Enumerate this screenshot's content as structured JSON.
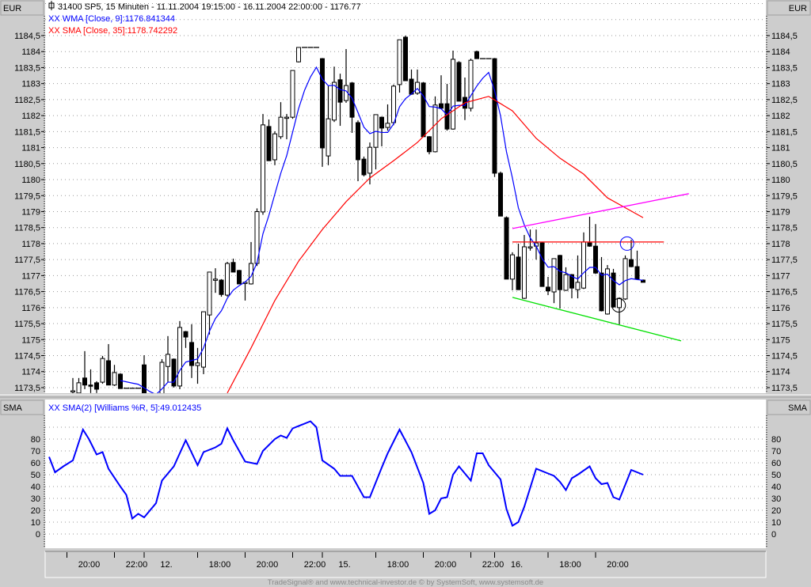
{
  "header": {
    "instrument_line": "31400  SP5, 15 Minuten - 11.11.2004 19:15:00 - 16.11.2004 22:00:00 - 1176.77",
    "wma_label": "XX WMA [Close, 9]:1176.841344",
    "sma_label": "XX SMA [Close, 35]:1178.742292",
    "currency_left": "EUR",
    "currency_right": "EUR"
  },
  "lower_panel": {
    "title_left": "SMA",
    "title_right": "SMA",
    "indicator_label": "XX SMA(2) [Williams %R, 5]:49.012435"
  },
  "footer": "TradeSignal® and www.technical-investor.de © by SystemSoft, www.systemsoft.de",
  "colors": {
    "wma": "#0000ff",
    "sma": "#ff0000",
    "resistance": "#ff0000",
    "upper_trend": "#ff00ff",
    "lower_trend": "#00e000",
    "indicator": "#0000ff"
  },
  "chart_data": [
    {
      "type": "candlestick",
      "title": "31400  SP5, 15 Minuten",
      "ylabel": "EUR",
      "ylim": [
        1173.3,
        1185.6
      ],
      "y_ticks": [
        "1184,5",
        "1184",
        "1183,5",
        "1183",
        "1182,5",
        "1182",
        "1181,5",
        "1181",
        "1180,5",
        "1180",
        "1179,5",
        "1179",
        "1178,5",
        "1178",
        "1177,5",
        "1177",
        "1176,5",
        "1176",
        "1175,5",
        "1175",
        "1174,5",
        "1174",
        "1173,5"
      ],
      "y_tick_values": [
        1184.5,
        1184,
        1183.5,
        1183,
        1182.5,
        1182,
        1181.5,
        1181,
        1180.5,
        1180,
        1179.5,
        1179,
        1178.5,
        1178,
        1177.5,
        1177,
        1176.5,
        1176,
        1175.5,
        1175,
        1174.5,
        1174,
        1173.5
      ],
      "x_ticks": [
        {
          "bar": -1,
          "label": "20:00"
        },
        {
          "bar": 7,
          "label": "22:00"
        },
        {
          "bar": 12,
          "label": "12."
        },
        {
          "bar": 21,
          "label": "18:00"
        },
        {
          "bar": 29,
          "label": "20:00"
        },
        {
          "bar": 37,
          "label": "22:00"
        },
        {
          "bar": 42,
          "label": "15."
        },
        {
          "bar": 51,
          "label": "18:00"
        },
        {
          "bar": 59,
          "label": "20:00"
        },
        {
          "bar": 67,
          "label": "22:00"
        },
        {
          "bar": 71,
          "label": "16."
        },
        {
          "bar": 80,
          "label": "18:00"
        },
        {
          "bar": 88,
          "label": "20:00"
        }
      ],
      "ohlc": [
        [
          1173.4,
          1173.8,
          1173.2,
          1173.4
        ],
        [
          1173.33,
          1173.8,
          1173.25,
          1173.65
        ],
        [
          1173.8,
          1174.64,
          1173.45,
          1173.58
        ],
        [
          1173.58,
          1174.07,
          1173.33,
          1173.55
        ],
        [
          1173.65,
          1173.7,
          1173.33,
          1173.45
        ],
        [
          1173.67,
          1174.49,
          1173.62,
          1174.41
        ],
        [
          1174.34,
          1174.86,
          1173.58,
          1173.58
        ],
        [
          1173.58,
          1174.21,
          1173.55,
          1173.97
        ],
        [
          1173.92,
          1173.95,
          1173.47,
          1173.47
        ],
        [
          1173.48,
          1173.48,
          1173.48,
          1173.48
        ],
        [
          1173.48,
          1173.48,
          1173.48,
          1173.48
        ],
        [
          1173.48,
          1173.48,
          1173.48,
          1173.48
        ],
        [
          1174.21,
          1174.51,
          1173.0,
          1173.1
        ],
        [
          1173.1,
          1173.3,
          1172.8,
          1173.0
        ],
        [
          1173.0,
          1173.2,
          1172.9,
          1173.1
        ],
        [
          1173.0,
          1174.39,
          1172.9,
          1174.29
        ],
        [
          1174.16,
          1175.11,
          1173.67,
          1174.54
        ],
        [
          1174.39,
          1174.41,
          1173.5,
          1173.55
        ],
        [
          1173.55,
          1175.58,
          1173.45,
          1175.38
        ],
        [
          1175.25,
          1175.27,
          1174.74,
          1175.08
        ],
        [
          1174.91,
          1175.48,
          1173.8,
          1174.19
        ],
        [
          1174.19,
          1174.74,
          1173.62,
          1174.27
        ],
        [
          1174.14,
          1175.87,
          1173.92,
          1175.87
        ],
        [
          1175.77,
          1177.11,
          1175.16,
          1177.11
        ],
        [
          1176.89,
          1177.23,
          1176.46,
          1176.89
        ],
        [
          1176.86,
          1176.89,
          1176.34,
          1176.41
        ],
        [
          1176.39,
          1177.43,
          1176.34,
          1177.38
        ],
        [
          1177.41,
          1177.53,
          1177.11,
          1177.11
        ],
        [
          1177.16,
          1177.18,
          1176.74,
          1176.74
        ],
        [
          1176.79,
          1176.81,
          1176.22,
          1176.79
        ],
        [
          1176.74,
          1178.05,
          1176.72,
          1177.38
        ],
        [
          1177.38,
          1179.1,
          1177.3,
          1179.0
        ],
        [
          1178.99,
          1182.05,
          1178.9,
          1181.71
        ],
        [
          1181.66,
          1181.88,
          1180.59,
          1180.59
        ],
        [
          1180.62,
          1181.51,
          1180.45,
          1181.43
        ],
        [
          1181.34,
          1182.42,
          1181.27,
          1181.95
        ],
        [
          1181.95,
          1182.05,
          1181.26,
          1181.95
        ],
        [
          1181.95,
          1183.41,
          1181.9,
          1183.41
        ],
        [
          1183.68,
          1184.13,
          1183.66,
          1184.13
        ],
        [
          1184.13,
          1184.13,
          1184.13,
          1184.13
        ],
        [
          1184.13,
          1184.13,
          1184.13,
          1184.13
        ],
        [
          1184.13,
          1184.13,
          1184.13,
          1184.13
        ],
        [
          1183.78,
          1183.8,
          1180.4,
          1180.99
        ],
        [
          1180.74,
          1182.92,
          1180.45,
          1181.9
        ],
        [
          1181.86,
          1183.53,
          1181.8,
          1183.04
        ],
        [
          1183.12,
          1183.31,
          1181.68,
          1182.42
        ],
        [
          1182.47,
          1184.08,
          1182.4,
          1182.94
        ],
        [
          1183.02,
          1183.05,
          1181.46,
          1181.95
        ],
        [
          1181.78,
          1181.85,
          1179.95,
          1180.62
        ],
        [
          1180.64,
          1180.72,
          1180.1,
          1180.15
        ],
        [
          1180.2,
          1181.16,
          1179.85,
          1181.01
        ],
        [
          1181.01,
          1182.03,
          1180.32,
          1182.03
        ],
        [
          1181.95,
          1181.97,
          1181.04,
          1181.61
        ],
        [
          1181.63,
          1182.35,
          1181.53,
          1181.76
        ],
        [
          1181.78,
          1182.97,
          1181.7,
          1182.92
        ],
        [
          1182.97,
          1184.37,
          1182.72,
          1184.37
        ],
        [
          1184.45,
          1184.5,
          1183.09,
          1183.09
        ],
        [
          1183.14,
          1183.44,
          1182.65,
          1182.67
        ],
        [
          1182.7,
          1183.44,
          1182.65,
          1183.04
        ],
        [
          1183.02,
          1183.05,
          1181.34,
          1181.34
        ],
        [
          1181.34,
          1181.36,
          1180.79,
          1180.87
        ],
        [
          1180.87,
          1182.6,
          1180.85,
          1182.33
        ],
        [
          1182.37,
          1183.26,
          1182.2,
          1182.23
        ],
        [
          1182.37,
          1182.99,
          1181.53,
          1181.58
        ],
        [
          1181.58,
          1184.03,
          1181.56,
          1183.76
        ],
        [
          1183.66,
          1183.7,
          1182.45,
          1182.45
        ],
        [
          1182.57,
          1183.19,
          1181.86,
          1182.23
        ],
        [
          1182.23,
          1183.78,
          1182.13,
          1183.73
        ],
        [
          1184.0,
          1184.03,
          1183.78,
          1183.78
        ],
        [
          1183.78,
          1183.78,
          1183.78,
          1183.78
        ],
        [
          1183.78,
          1183.78,
          1183.78,
          1183.78
        ],
        [
          1183.78,
          1183.8,
          1180.08,
          1180.2
        ],
        [
          1180.2,
          1180.25,
          1178.86,
          1178.86
        ],
        [
          1178.81,
          1178.85,
          1176.89,
          1176.89
        ],
        [
          1176.89,
          1177.73,
          1176.54,
          1177.65
        ],
        [
          1177.58,
          1178.0,
          1176.56,
          1176.56
        ],
        [
          1176.29,
          1178.27,
          1176.27,
          1177.9
        ],
        [
          1177.9,
          1178.44,
          1177.78,
          1177.9
        ],
        [
          1177.92,
          1178.44,
          1177.5,
          1178.02
        ],
        [
          1178.02,
          1178.05,
          1176.66,
          1176.66
        ],
        [
          1176.64,
          1176.96,
          1176.39,
          1176.52
        ],
        [
          1176.49,
          1177.53,
          1176.14,
          1177.53
        ],
        [
          1177.63,
          1177.65,
          1175.97,
          1176.56
        ],
        [
          1176.54,
          1177.26,
          1176.52,
          1177.03
        ],
        [
          1177.03,
          1177.05,
          1176.29,
          1176.61
        ],
        [
          1176.56,
          1177.63,
          1176.29,
          1176.79
        ],
        [
          1176.61,
          1178.35,
          1176.58,
          1178.05
        ],
        [
          1178.02,
          1178.84,
          1177.9,
          1177.92
        ],
        [
          1177.92,
          1178.61,
          1177.05,
          1177.08
        ],
        [
          1177.08,
          1177.58,
          1175.88,
          1175.9
        ],
        [
          1175.8,
          1177.33,
          1175.78,
          1177.21
        ],
        [
          1177.08,
          1177.21,
          1176.0,
          1176.02
        ],
        [
          1176.0,
          1176.32,
          1175.48,
          1176.29
        ],
        [
          1176.27,
          1177.63,
          1176.24,
          1177.53
        ],
        [
          1177.5,
          1178.12,
          1177.26,
          1177.28
        ],
        [
          1177.28,
          1177.78,
          1176.86,
          1176.89
        ],
        [
          1176.86,
          1176.88,
          1176.79,
          1176.79
        ]
      ],
      "series": [
        {
          "name": "WMA [Close, 9]",
          "method": "wma",
          "period": 9
        },
        {
          "name": "SMA [Close, 35]",
          "points": [
            [
              26,
              1173.33
            ],
            [
              30,
              1174.74
            ],
            [
              34,
              1176.22
            ],
            [
              38,
              1177.45
            ],
            [
              42,
              1178.44
            ],
            [
              46,
              1179.31
            ],
            [
              50,
              1180.05
            ],
            [
              54,
              1180.59
            ],
            [
              58,
              1181.16
            ],
            [
              62,
              1181.9
            ],
            [
              66,
              1182.4
            ],
            [
              70,
              1182.6
            ],
            [
              74,
              1182.15
            ],
            [
              78,
              1181.29
            ],
            [
              82,
              1180.67
            ],
            [
              86,
              1180.17
            ],
            [
              90,
              1179.43
            ],
            [
              96,
              1178.81
            ]
          ]
        }
      ],
      "annotations": [
        {
          "type": "trendline",
          "name": "upper-trendline",
          "from": [
            74,
            1178.47
          ],
          "to": [
            103.7,
            1179.56
          ]
        },
        {
          "type": "hline",
          "name": "resistance-line",
          "from": [
            74,
            1178.05
          ],
          "to": [
            99.5,
            1178.05
          ]
        },
        {
          "type": "trendline",
          "name": "lower-trendline",
          "from": [
            74,
            1176.32
          ],
          "to": [
            102.4,
            1174.96
          ]
        },
        {
          "type": "circle",
          "name": "blue-circle-marker",
          "at": [
            93.3,
            1178.0
          ]
        },
        {
          "type": "circle",
          "name": "black-circle-marker",
          "at": [
            91.9,
            1176.07
          ]
        }
      ]
    },
    {
      "type": "line",
      "title": "SMA(2) [Williams %R, 5]",
      "ylim": [
        -5,
        120
      ],
      "y_ticks": [
        "80",
        "70",
        "60",
        "50",
        "40",
        "30",
        "20",
        "10",
        "0"
      ],
      "y_tick_values": [
        80,
        70,
        60,
        50,
        40,
        30,
        20,
        10,
        0
      ],
      "points": [
        [
          -4,
          65
        ],
        [
          -3,
          52
        ],
        [
          -1.6,
          57
        ],
        [
          0,
          62
        ],
        [
          1.7,
          88
        ],
        [
          2.7,
          80
        ],
        [
          4,
          67
        ],
        [
          5,
          69
        ],
        [
          6,
          55
        ],
        [
          8,
          40
        ],
        [
          9,
          33
        ],
        [
          10,
          13
        ],
        [
          11,
          17
        ],
        [
          12,
          14
        ],
        [
          14,
          26
        ],
        [
          15,
          45
        ],
        [
          17,
          57
        ],
        [
          19,
          79
        ],
        [
          21,
          58
        ],
        [
          22,
          69
        ],
        [
          24,
          73
        ],
        [
          25,
          76
        ],
        [
          26,
          89
        ],
        [
          27,
          79
        ],
        [
          29,
          61
        ],
        [
          31,
          59
        ],
        [
          32,
          70
        ],
        [
          34,
          80
        ],
        [
          35,
          83
        ],
        [
          36,
          81
        ],
        [
          37,
          89
        ],
        [
          40,
          95
        ],
        [
          41,
          90
        ],
        [
          42,
          62
        ],
        [
          44,
          55
        ],
        [
          45,
          49
        ],
        [
          47,
          49
        ],
        [
          49,
          31
        ],
        [
          50,
          31
        ],
        [
          52,
          56
        ],
        [
          53,
          68
        ],
        [
          55,
          88
        ],
        [
          57,
          69
        ],
        [
          59,
          43
        ],
        [
          60,
          17
        ],
        [
          61,
          20
        ],
        [
          62,
          30
        ],
        [
          63,
          31
        ],
        [
          64,
          50
        ],
        [
          65,
          57
        ],
        [
          67,
          45
        ],
        [
          68,
          68
        ],
        [
          69,
          68
        ],
        [
          70,
          58
        ],
        [
          72,
          46
        ],
        [
          73,
          21
        ],
        [
          74,
          7
        ],
        [
          75,
          10
        ],
        [
          76,
          23
        ],
        [
          78,
          55
        ],
        [
          80,
          51
        ],
        [
          81,
          49
        ],
        [
          82,
          44
        ],
        [
          83,
          37
        ],
        [
          84,
          47
        ],
        [
          85,
          50
        ],
        [
          87,
          57
        ],
        [
          88,
          47
        ],
        [
          89,
          42
        ],
        [
          90,
          43
        ],
        [
          91,
          31
        ],
        [
          92,
          29
        ],
        [
          94,
          54
        ],
        [
          96,
          50
        ]
      ]
    }
  ]
}
